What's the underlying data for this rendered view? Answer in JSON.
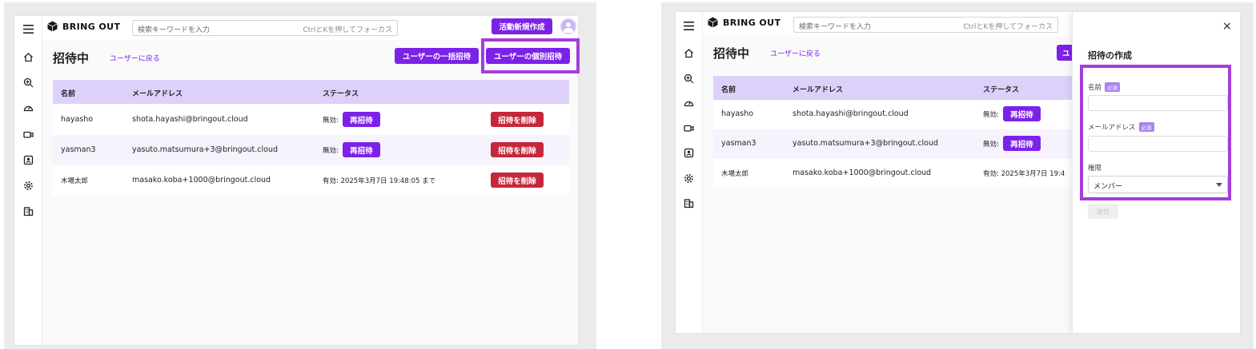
{
  "brand": {
    "name": "BRING OUT"
  },
  "search": {
    "placeholder": "検索キーワードを入力",
    "shortcut": "CtrlとKを押してフォーカス"
  },
  "header": {
    "new_activity_button": "活動新規作成"
  },
  "page": {
    "title": "招待中",
    "back_link": "ユーザーに戻る",
    "bulk_invite_button": "ユーザーの一括招待",
    "individual_invite_button": "ユーザーの個別招待"
  },
  "table": {
    "columns": [
      "名前",
      "メールアドレス",
      "ステータス"
    ],
    "rows": [
      {
        "name": "hayasho",
        "email": "shota.hayashi@bringout.cloud",
        "status": "無効:",
        "action_reinvite": "再招待",
        "action_delete": "招待を削除"
      },
      {
        "name": "yasman3",
        "email": "yasuto.matsumura+3@bringout.cloud",
        "status": "無効:",
        "action_reinvite": "再招待",
        "action_delete": "招待を削除"
      },
      {
        "name": "木場太郎",
        "email": "masako.koba+1000@bringout.cloud",
        "status": "有効: 2025年3月7日 19:48:05 まで",
        "action_delete": "招待を削除"
      }
    ],
    "right_status_row3": "有効: 2025年3月7日 19:4"
  },
  "drawer": {
    "title": "招待の作成",
    "close": "×",
    "name_label": "名前",
    "email_label": "メールアドレス",
    "required_badge": "必須",
    "role_label": "権限",
    "role_value": "メンバー",
    "submit": "送信"
  },
  "right_page": {
    "partial_button": "ユ"
  },
  "colors": {
    "accent": "#7c22e8",
    "danger": "#c5273b",
    "highlight": "#a43ddd",
    "table_header": "#ddd1fb"
  },
  "icons": [
    "menu-icon",
    "home-icon",
    "search-zoom-icon",
    "dashboard-icon",
    "video-icon",
    "badge-icon",
    "gear-icon",
    "building-icon",
    "cube-logo-icon"
  ]
}
